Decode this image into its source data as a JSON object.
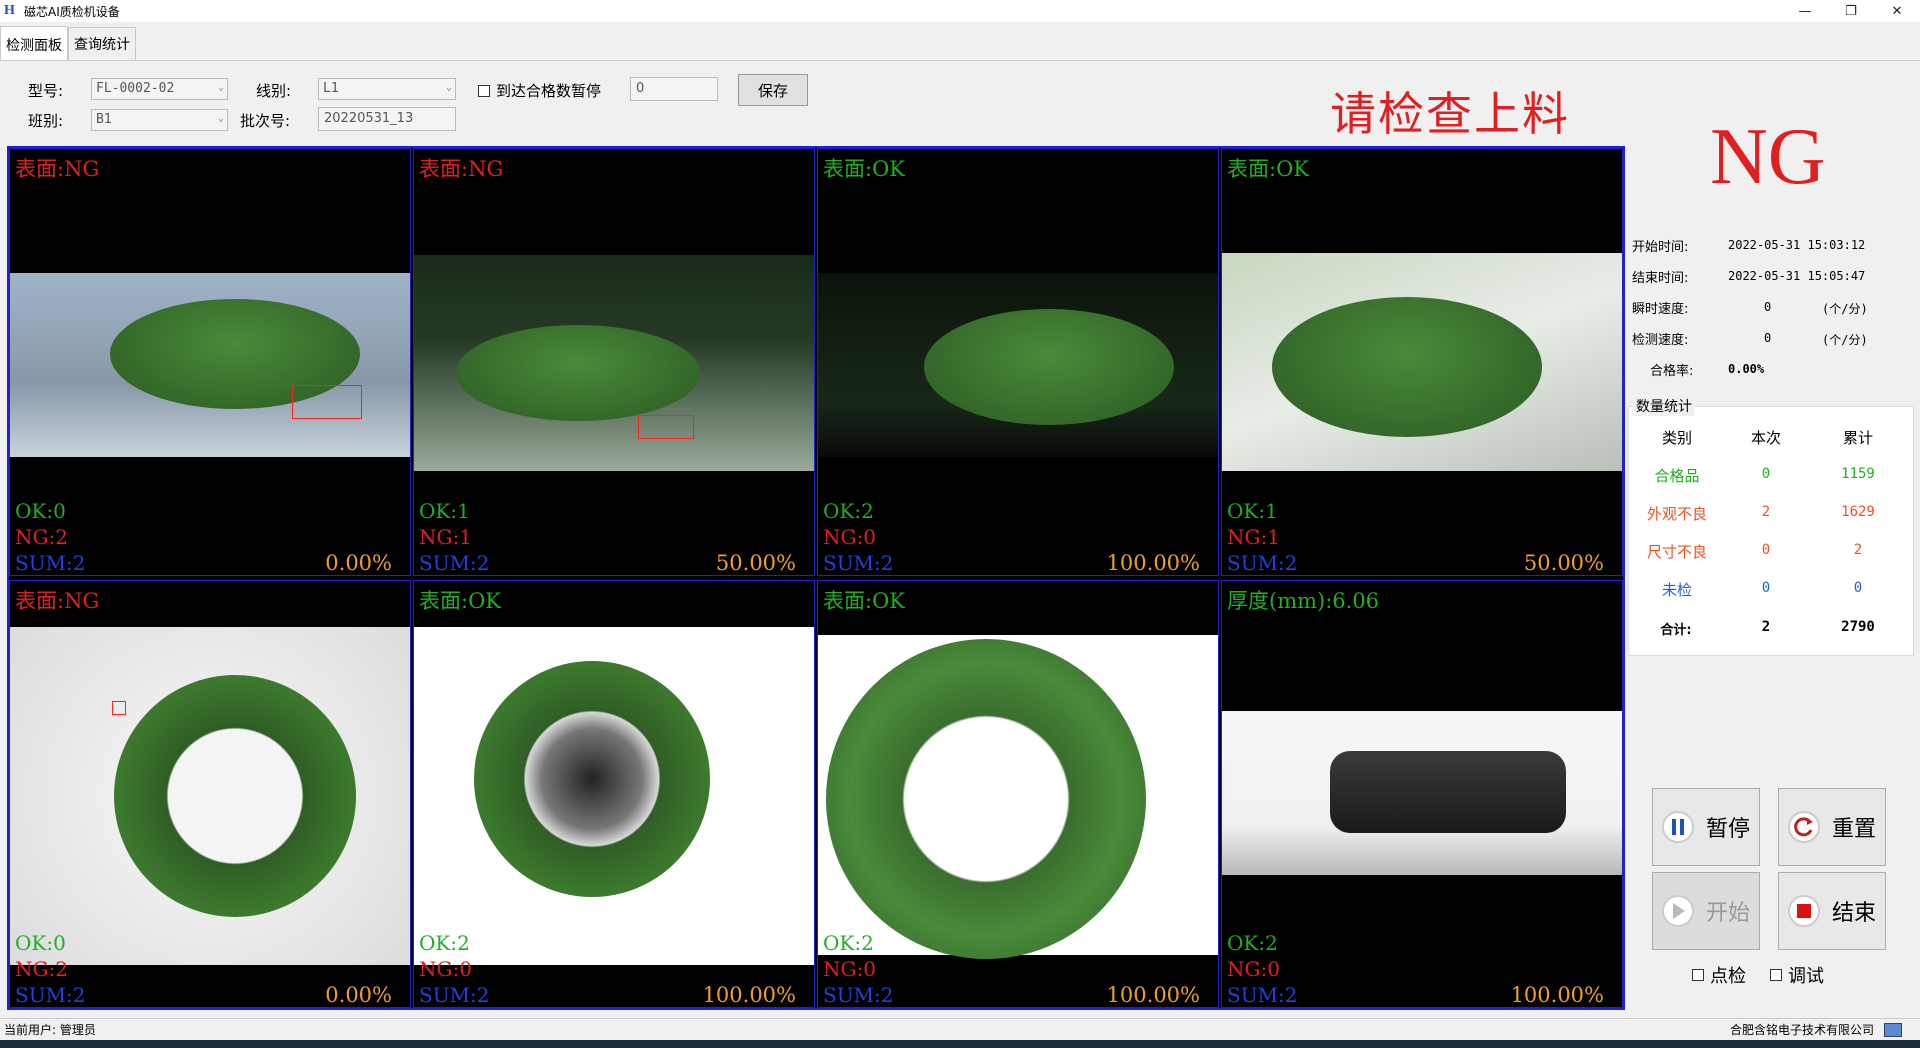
{
  "window": {
    "title": "磁芯AI质检机设备",
    "icon": "H"
  },
  "tabs": [
    "检测面板",
    "查询统计"
  ],
  "form": {
    "model_label": "型号:",
    "model_value": "FL-0002-02",
    "line_label": "线别:",
    "line_value": "L1",
    "pause_check_label": "到达合格数暂停",
    "pause_count": "0",
    "save_label": "保存",
    "shift_label": "班别:",
    "shift_value": "B1",
    "batch_label": "批次号:",
    "batch_value": "20220531_13"
  },
  "notice": "请检查上料",
  "cells": [
    {
      "head": "表面:NG",
      "head_status": "ng",
      "ok": "OK:0",
      "ng": "NG:2",
      "sum": "SUM:2",
      "pct": "0.00%"
    },
    {
      "head": "表面:NG",
      "head_status": "ng",
      "ok": "OK:1",
      "ng": "NG:1",
      "sum": "SUM:2",
      "pct": "50.00%"
    },
    {
      "head": "表面:OK",
      "head_status": "ok",
      "ok": "OK:2",
      "ng": "NG:0",
      "sum": "SUM:2",
      "pct": "100.00%"
    },
    {
      "head": "表面:OK",
      "head_status": "ok",
      "ok": "OK:1",
      "ng": "NG:1",
      "sum": "SUM:2",
      "pct": "50.00%"
    },
    {
      "head": "表面:NG",
      "head_status": "ng",
      "ok": "OK:0",
      "ng": "NG:2",
      "sum": "SUM:2",
      "pct": "0.00%"
    },
    {
      "head": "表面:OK",
      "head_status": "ok",
      "ok": "OK:2",
      "ng": "NG:0",
      "sum": "SUM:2",
      "pct": "100.00%"
    },
    {
      "head": "表面:OK",
      "head_status": "ok",
      "ok": "OK:2",
      "ng": "NG:0",
      "sum": "SUM:2",
      "pct": "100.00%"
    },
    {
      "head": "厚度(mm):6.06",
      "head_status": "ok",
      "ok": "OK:2",
      "ng": "NG:0",
      "sum": "SUM:2",
      "pct": "100.00%"
    }
  ],
  "result": "NG",
  "info": {
    "start_label": "开始时间:",
    "start_value": "2022-05-31 15:03:12",
    "end_label": "结束时间:",
    "end_value": "2022-05-31 15:05:47",
    "instant_label": "瞬时速度:",
    "instant_value": "0",
    "instant_unit": "(个/分)",
    "detect_label": "检测速度:",
    "detect_value": "0",
    "detect_unit": "(个/分)",
    "rate_label": "合格率:",
    "rate_value": "0.00%"
  },
  "stats": {
    "title": "数量统计",
    "headers": [
      "类别",
      "本次",
      "累计"
    ],
    "rows": [
      {
        "name": "合格品",
        "current": "0",
        "total": "1159",
        "color": "#20b020"
      },
      {
        "name": "外观不良",
        "current": "2",
        "total": "1629",
        "color": "#f05020"
      },
      {
        "name": "尺寸不良",
        "current": "0",
        "total": "2",
        "color": "#f05020"
      },
      {
        "name": "未检",
        "current": "0",
        "total": "0",
        "color": "#2060e0"
      }
    ],
    "total_label": "合计:",
    "total_current": "2",
    "total_total": "2790"
  },
  "buttons": {
    "pause": "暂停",
    "reset": "重置",
    "start": "开始",
    "stop": "结束"
  },
  "checks": {
    "spot": "点检",
    "debug": "调试"
  },
  "statusbar": {
    "user": "当前用户: 管理员",
    "company": "合肥含铭电子技术有限公司"
  }
}
